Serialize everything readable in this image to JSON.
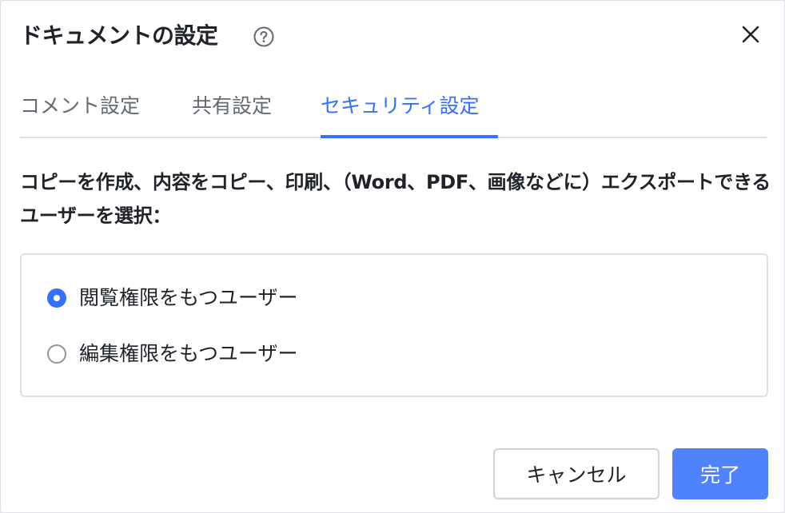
{
  "dialog": {
    "title": "ドキュメントの設定",
    "icons": {
      "help": "help-circle-icon",
      "close": "close-icon"
    }
  },
  "tabs": [
    {
      "label": "コメント設定",
      "active": false
    },
    {
      "label": "共有設定",
      "active": false
    },
    {
      "label": "セキュリティ設定",
      "active": true
    }
  ],
  "security": {
    "description": "コピーを作成、内容をコピー、印刷、（Word、PDF、画像などに）エクスポートできるユーザーを選択：",
    "options": [
      {
        "label": "閲覧権限をもつユーザー",
        "selected": true
      },
      {
        "label": "編集権限をもつユーザー",
        "selected": false
      }
    ]
  },
  "footer": {
    "cancel_label": "キャンセル",
    "done_label": "完了"
  },
  "colors": {
    "accent": "#3370ff",
    "primary_button": "#4e83fd",
    "text": "#1f2329",
    "muted_text": "#646a73",
    "border": "#dee0e3"
  }
}
